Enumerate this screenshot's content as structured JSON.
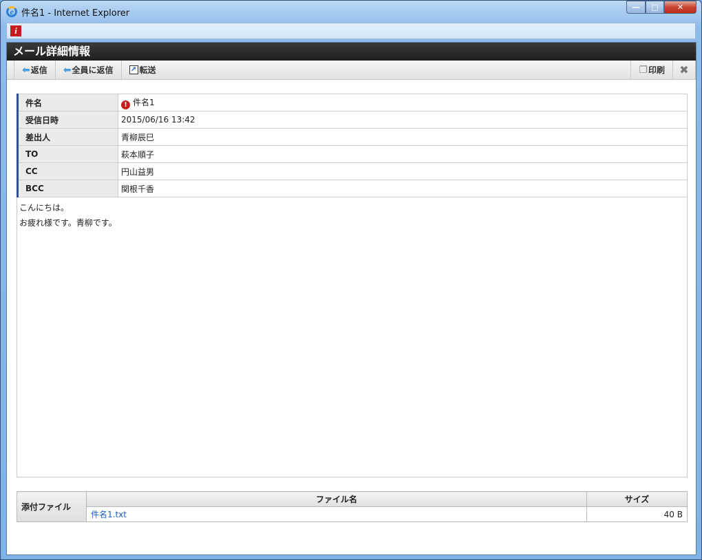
{
  "window": {
    "title": "件名1 - Internet Explorer",
    "min": "—",
    "max": "□",
    "close": "✕"
  },
  "app": {
    "logo": "i",
    "header": "メール詳細情報"
  },
  "toolbar": {
    "reply": "返信",
    "reply_all": "全員に返信",
    "forward": "転送",
    "print": "印刷",
    "close": "✖"
  },
  "fields": [
    {
      "label": "件名",
      "value": "件名1",
      "priority": "!"
    },
    {
      "label": "受信日時",
      "value": "2015/06/16 13:42"
    },
    {
      "label": "差出人",
      "value": "青柳辰巳"
    },
    {
      "label": "TO",
      "value": "萩本順子"
    },
    {
      "label": "CC",
      "value": "円山益男"
    },
    {
      "label": "BCC",
      "value": "関根千香"
    }
  ],
  "body": [
    "こんにちは。",
    "お疲れ様です。青柳です。"
  ],
  "attachments": {
    "label": "添付ファイル",
    "col_name": "ファイル名",
    "col_size": "サイズ",
    "files": [
      {
        "name": "件名1.txt",
        "size": "40 B"
      }
    ]
  }
}
